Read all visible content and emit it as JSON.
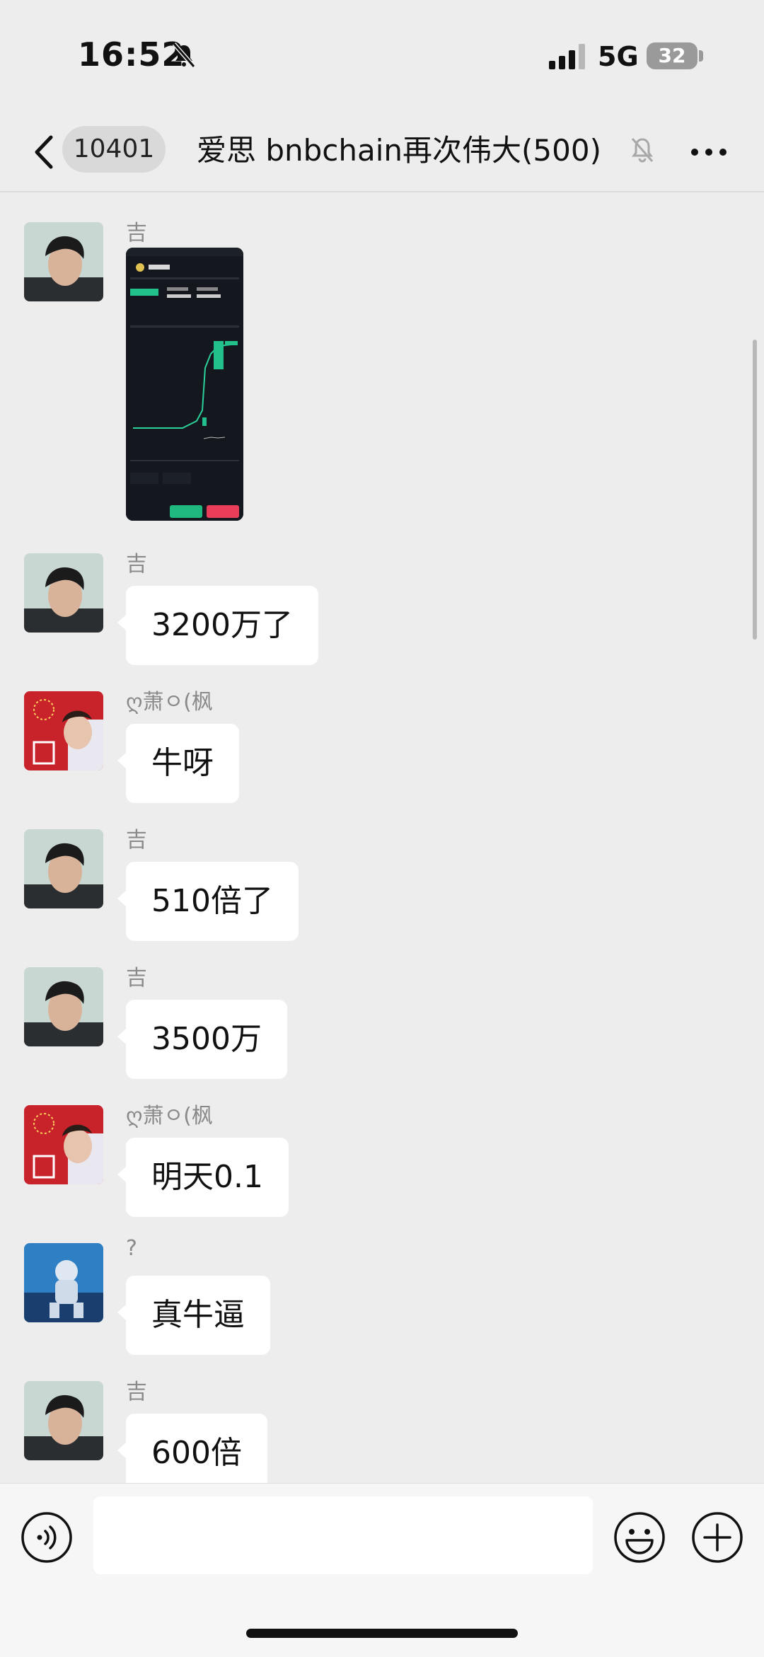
{
  "status_bar": {
    "time": "16:52",
    "network": "5G",
    "battery": "32"
  },
  "header": {
    "unread_count": "10401",
    "title": "爱思  bnbchain再次伟大(500)"
  },
  "messages": [
    {
      "sender": "吉",
      "type": "image",
      "avatar": "man-portrait"
    },
    {
      "sender": "吉",
      "text": "3200万了",
      "avatar": "man-portrait"
    },
    {
      "sender": "ღ萧ㅇ(枫",
      "text": "牛呀",
      "avatar": "red-firework-portrait"
    },
    {
      "sender": "吉",
      "text": "510倍了",
      "avatar": "man-portrait"
    },
    {
      "sender": "吉",
      "text": "3500万",
      "avatar": "man-portrait"
    },
    {
      "sender": "ღ萧ㅇ(枫",
      "text": "明天0.1",
      "avatar": "red-firework-portrait"
    },
    {
      "sender": "?",
      "text": "真牛逼",
      "avatar": "astronaut-portrait"
    },
    {
      "sender": "吉",
      "text": "600倍",
      "avatar": "man-portrait"
    }
  ],
  "colors": {
    "background": "#ededed",
    "bubble": "#ffffff",
    "sender": "#8a8a8a"
  },
  "icons": [
    "back-arrow-icon",
    "mute-bell-icon",
    "more-dots-icon",
    "voice-icon",
    "emoji-icon",
    "plus-icon"
  ]
}
